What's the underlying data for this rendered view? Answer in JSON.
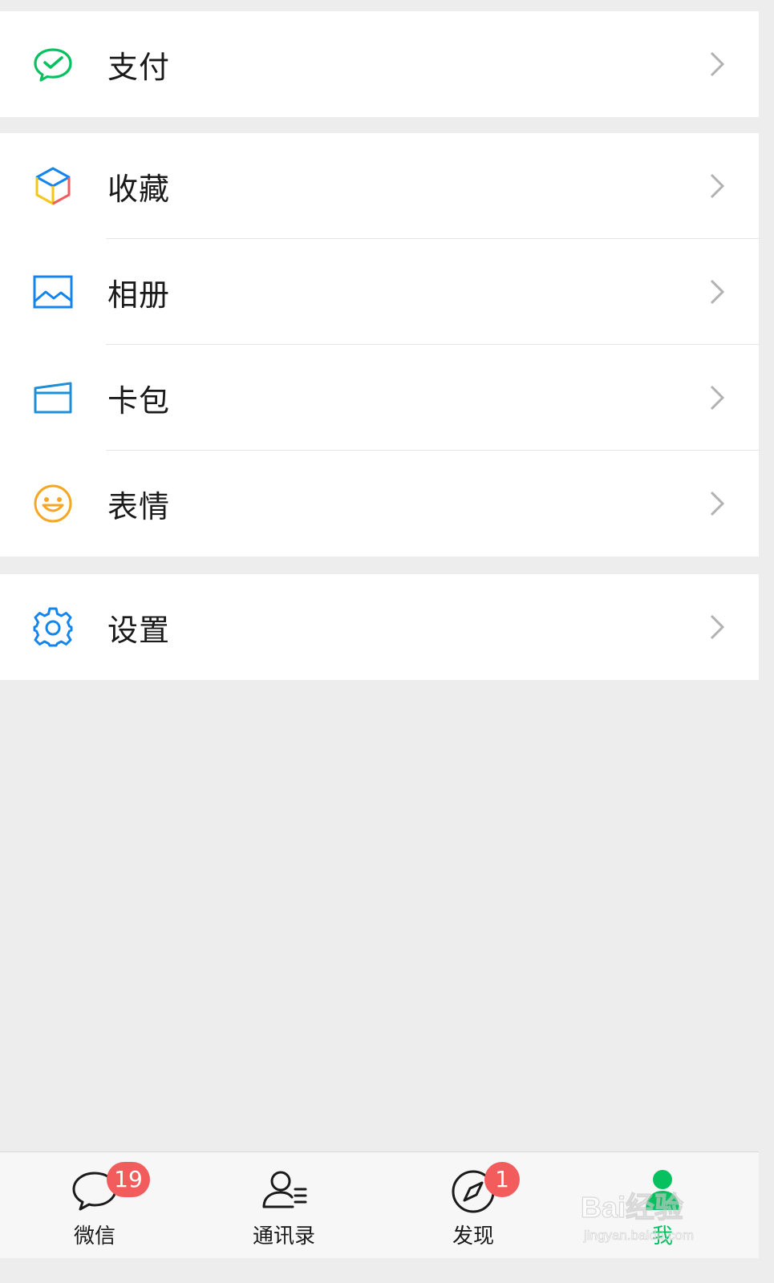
{
  "groups": [
    {
      "items": [
        {
          "label": "支付",
          "icon": "wechat-pay-icon"
        }
      ]
    },
    {
      "items": [
        {
          "label": "收藏",
          "icon": "favorites-cube-icon"
        },
        {
          "label": "相册",
          "icon": "album-image-icon"
        },
        {
          "label": "卡包",
          "icon": "card-wallet-icon"
        },
        {
          "label": "表情",
          "icon": "sticker-smile-icon"
        }
      ]
    },
    {
      "items": [
        {
          "label": "设置",
          "icon": "settings-gear-icon"
        }
      ]
    }
  ],
  "tabbar": {
    "tabs": [
      {
        "label": "微信",
        "icon": "chat-bubble-icon",
        "badge": "19"
      },
      {
        "label": "通讯录",
        "icon": "contacts-icon"
      },
      {
        "label": "发现",
        "icon": "discover-compass-icon",
        "badge": "1"
      },
      {
        "label": "我",
        "icon": "me-person-icon",
        "active": true
      }
    ]
  },
  "watermark": {
    "brand": "Bai经验",
    "url": "jingyan.baidu.com"
  },
  "colors": {
    "accent": "#07c160",
    "badge": "#f25c5c",
    "background": "#ededed",
    "icon_blue": "#1485ee",
    "icon_orange": "#f5a623"
  }
}
